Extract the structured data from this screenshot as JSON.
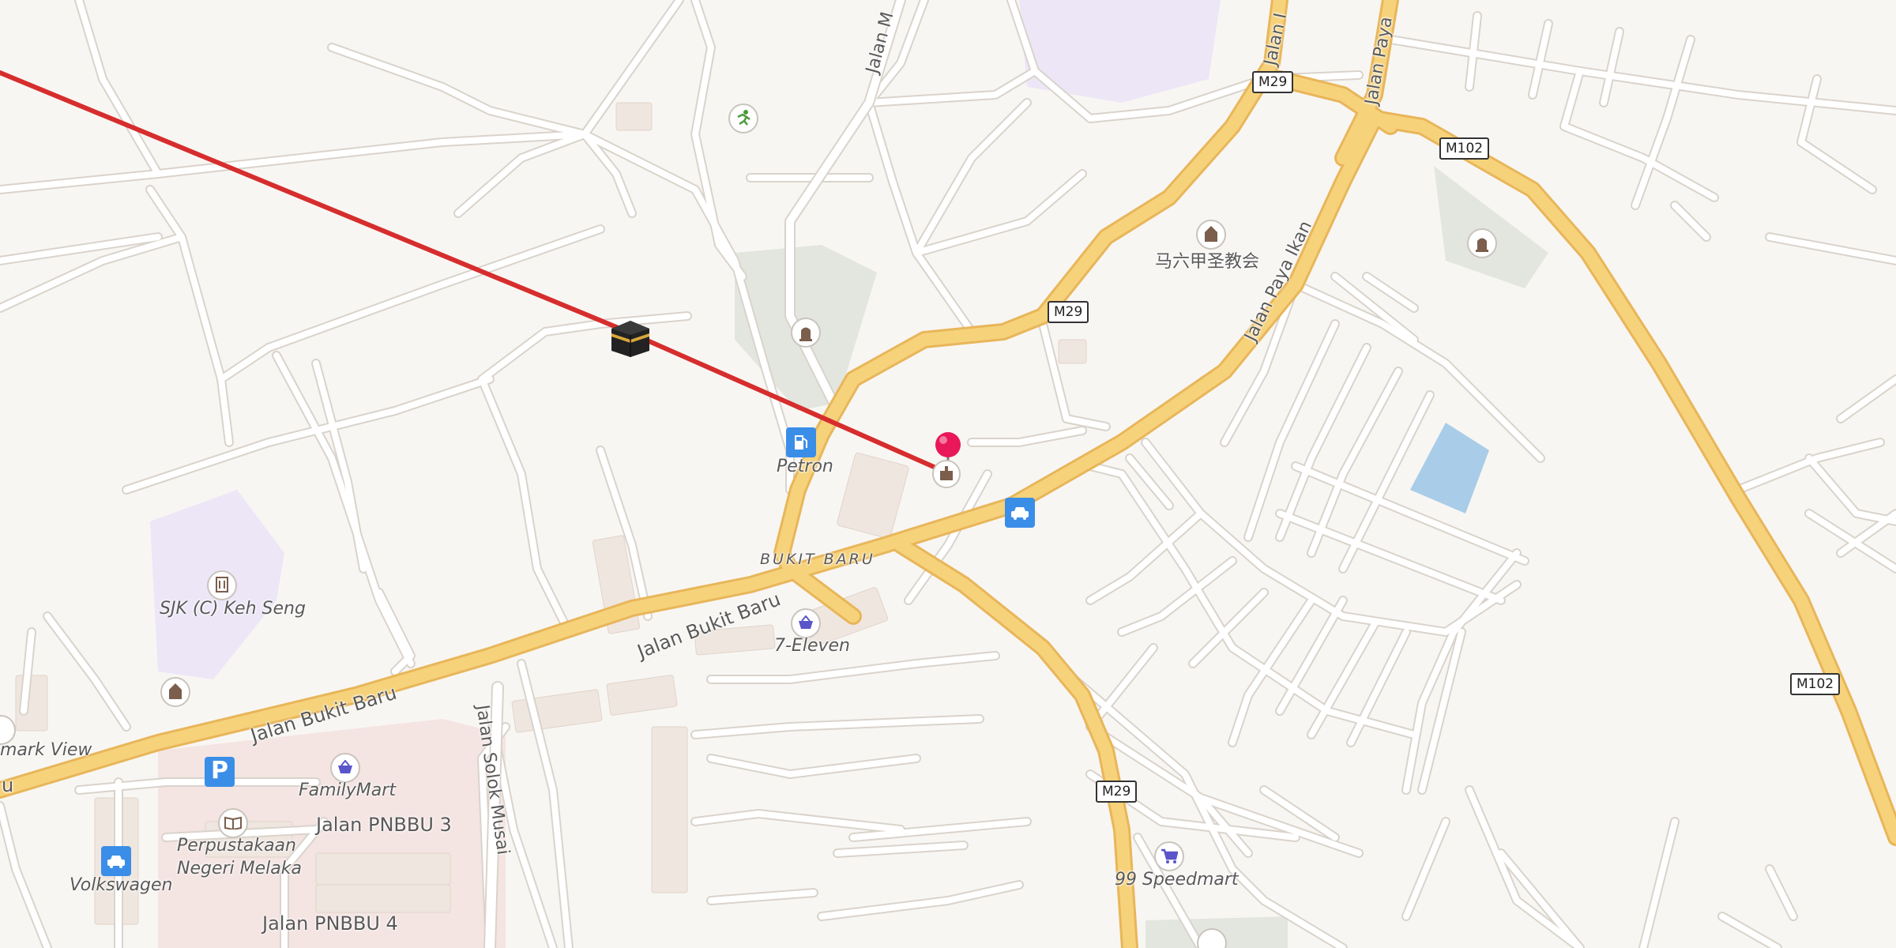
{
  "colors": {
    "background": "#f8f6f3",
    "major_road": "#f6d27b",
    "major_road_casing": "#e8b65a",
    "minor_road": "#ffffff",
    "minor_road_casing": "#d9d3cb",
    "route_line": "#d62d2d",
    "park": "#e3e6df",
    "school_area": "#ece6f7",
    "water": "#a9cde8",
    "commercial": "#f4e4e2",
    "building": "#efe6df",
    "pin": "#e8185a",
    "poi_blue": "#3b8ee8"
  },
  "labels": {
    "petron": "Petron",
    "bukit_baru": "BUKIT BARU",
    "seven_eleven": "7-Eleven",
    "sjk": "SJK (C) Keh Seng",
    "mark_view": "mark View",
    "familymart": "FamilyMart",
    "perpustakaan_1": "Perpustakaan",
    "perpustakaan_2": "Negeri Melaka",
    "volkswagen": "Volkswagen",
    "speedmart": "99 Speedmart",
    "church_cn": "马六甲圣教会",
    "jalan_pnbbu3": "Jalan PNBBU 3",
    "jalan_pnbbu4": "Jalan PNBBU 4",
    "jalan_bukit_baru_1": "Jalan Bukit Baru",
    "jalan_bukit_baru_2": "Jalan Bukit Baru",
    "jalan_solok_musai": "Jalan Solok Musai",
    "jalan_paya_ikan": "Jalan Paya Ikan",
    "jalan_paya_top": "Jalan Paya",
    "jalan_m_top": "Jalan M",
    "jalan_top2": "Jalan I",
    "baru_edge": "u"
  },
  "shields": {
    "m29_top": "M29",
    "m29_mid": "M29",
    "m29_bottom": "M29",
    "m102_top": "M102",
    "m102_right": "M102"
  },
  "icons": {
    "kaaba": "kaaba-icon",
    "pin": "location-pin-icon",
    "fuel": "fuel-icon",
    "car_rental": "car-icon",
    "shop": "shopping-basket-icon",
    "cart": "shopping-cart-icon",
    "parking": "parking-icon",
    "library": "book-icon",
    "school": "school-icon",
    "place_of_worship": "worship-icon",
    "cemetery": "cemetery-icon",
    "sport": "running-icon"
  }
}
